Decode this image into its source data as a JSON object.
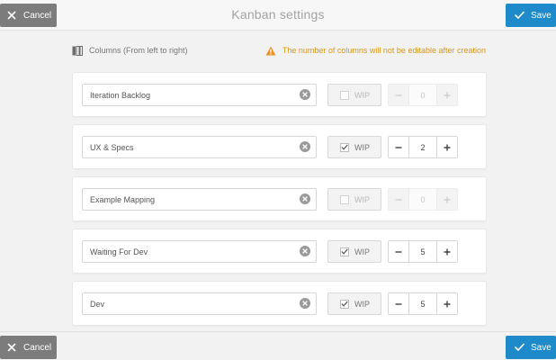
{
  "header": {
    "title": "Kanban settings",
    "cancel_label": "Cancel",
    "save_label": "Save"
  },
  "info": {
    "columns_label": "Columns (From left to right)",
    "warning_text": "The number of columns will not be editable after creation"
  },
  "columns": [
    {
      "name": "Iteration Backlog",
      "wip_label": "WIP",
      "wip_enabled": false,
      "wip_value": "0"
    },
    {
      "name": "UX & Specs",
      "wip_label": "WIP",
      "wip_enabled": true,
      "wip_value": "2"
    },
    {
      "name": "Example Mapping",
      "wip_label": "WIP",
      "wip_enabled": false,
      "wip_value": "0"
    },
    {
      "name": "Waiting For Dev",
      "wip_label": "WIP",
      "wip_enabled": true,
      "wip_value": "5"
    },
    {
      "name": "Dev",
      "wip_label": "WIP",
      "wip_enabled": true,
      "wip_value": "5"
    }
  ],
  "footer": {
    "cancel_label": "Cancel",
    "save_label": "Save"
  },
  "colors": {
    "save": "#1e8ac9",
    "cancel": "#7c7c7c",
    "warning": "#d9971c"
  },
  "icons": {
    "cancel": "close-icon",
    "save": "check-icon",
    "columns": "columns-icon",
    "warning": "warning-icon",
    "clear": "clear-input-icon"
  }
}
